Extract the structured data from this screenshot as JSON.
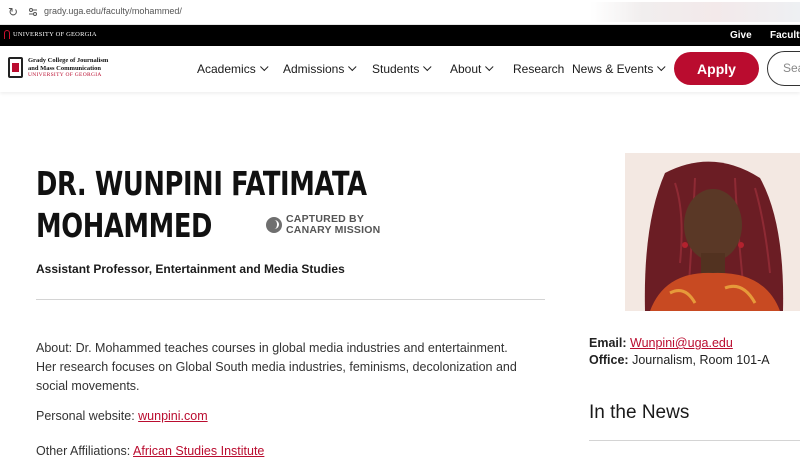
{
  "browser": {
    "url": "grady.uga.edu/faculty/mohammed/"
  },
  "uga_bar": {
    "logo_text": "UNIVERSITY OF GEORGIA",
    "links": [
      "Give",
      "Faculty"
    ]
  },
  "brand": {
    "line1": "Grady College of Journalism",
    "line2": "and Mass Communication",
    "line3": "UNIVERSITY OF GEORGIA"
  },
  "nav": {
    "items": [
      {
        "label": "Academics",
        "has_menu": true
      },
      {
        "label": "Admissions",
        "has_menu": true
      },
      {
        "label": "Students",
        "has_menu": true
      },
      {
        "label": "About",
        "has_menu": true
      },
      {
        "label": "Research",
        "has_menu": false
      },
      {
        "label": "News & Events",
        "has_menu": true
      }
    ],
    "apply_label": "Apply",
    "search_placeholder": "Sea"
  },
  "profile": {
    "name_line1": "DR. WUNPINI FATIMATA",
    "name_line2": "MOHAMMED",
    "badge_line1": "CAPTURED BY",
    "badge_line2": "CANARY MISSION",
    "title": "Assistant Professor, Entertainment and Media Studies",
    "about": "About: Dr. Mohammed teaches courses in global media industries and entertainment. Her research focuses on Global South media industries, feminisms, decolonization and social movements.",
    "website_label": "Personal website: ",
    "website_link": "wunpini.com",
    "affiliations_label": "Other Affiliations: ",
    "affiliations_link": "African Studies Institute"
  },
  "contact": {
    "email_label": "Email:",
    "email": "Wunpini@uga.edu",
    "office_label": "Office:",
    "office": "Journalism, Room 101-A"
  },
  "news_heading": "In the News",
  "colors": {
    "accent": "#ba0c2f",
    "topbar": "#000000"
  }
}
